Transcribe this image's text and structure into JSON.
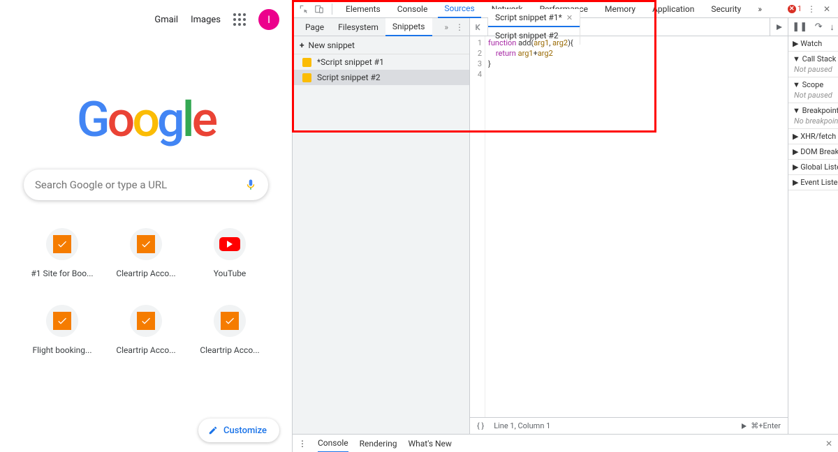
{
  "page": {
    "top_links": {
      "gmail": "Gmail",
      "images": "Images"
    },
    "avatar_letter": "I",
    "logo_letters": [
      "G",
      "o",
      "o",
      "g",
      "l",
      "e"
    ],
    "search_placeholder": "Search Google or type a URL",
    "shortcuts": [
      {
        "label": "#1 Site for Boo...",
        "kind": "tick"
      },
      {
        "label": "Cleartrip Acco...",
        "kind": "tick"
      },
      {
        "label": "YouTube",
        "kind": "yt"
      },
      {
        "label": "Flight booking...",
        "kind": "tick"
      },
      {
        "label": "Cleartrip Acco...",
        "kind": "tick"
      },
      {
        "label": "Cleartrip Acco...",
        "kind": "tick"
      }
    ],
    "customize_label": "Customize"
  },
  "devtools": {
    "top_tabs": [
      "Elements",
      "Console",
      "Sources",
      "Network",
      "Performance",
      "Memory",
      "Application",
      "Security"
    ],
    "top_active": 2,
    "more_glyph": "»",
    "error_count": "1",
    "nav_tabs": [
      "Page",
      "Filesystem",
      "Snippets"
    ],
    "nav_active": 2,
    "new_snippet_label": "New snippet",
    "snippets": [
      "*Script snippet #1",
      "Script snippet #2"
    ],
    "snippet_selected": 1,
    "editor_tabs": [
      {
        "label": "Script snippet #1*",
        "active": true,
        "closeable": true
      },
      {
        "label": "Script snippet #2",
        "active": false,
        "closeable": false
      }
    ],
    "code_lines": [
      "function add(arg1, arg2){",
      "    return arg1+arg2",
      "}",
      ""
    ],
    "gutter": [
      "1",
      "2",
      "3",
      "4"
    ],
    "status": {
      "position": "Line 1, Column 1",
      "run_hint": "⌘+Enter"
    },
    "sidebar": [
      {
        "title": "Watch",
        "open": false
      },
      {
        "title": "Call Stack",
        "open": true,
        "status": "Not paused"
      },
      {
        "title": "Scope",
        "open": true,
        "status": "Not paused"
      },
      {
        "title": "Breakpoints",
        "open": true,
        "status": "No breakpoints"
      },
      {
        "title": "XHR/fetch Breakpoints",
        "open": false
      },
      {
        "title": "DOM Breakpoints",
        "open": false
      },
      {
        "title": "Global Listeners",
        "open": false
      },
      {
        "title": "Event Listener Breakpoints",
        "open": false
      }
    ],
    "drawer_tabs": [
      "Console",
      "Rendering",
      "What's New"
    ],
    "drawer_active": 0
  }
}
